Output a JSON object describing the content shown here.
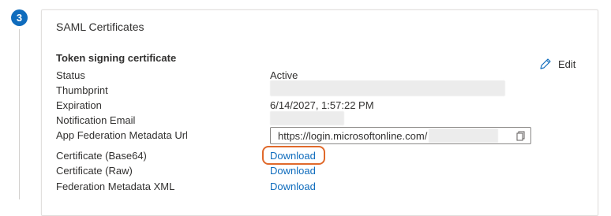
{
  "step": {
    "number": "3"
  },
  "card": {
    "title": "SAML Certificates",
    "section_title": "Token signing certificate",
    "edit_label": "Edit"
  },
  "rows": {
    "status": {
      "label": "Status",
      "value": "Active"
    },
    "thumbprint": {
      "label": "Thumbprint"
    },
    "expiration": {
      "label": "Expiration",
      "value": "6/14/2027, 1:57:22 PM"
    },
    "notification_email": {
      "label": "Notification Email"
    },
    "metadata_url": {
      "label": "App Federation Metadata Url",
      "value": "https://login.microsoftonline.com/"
    },
    "cert_base64": {
      "label": "Certificate (Base64)",
      "link": "Download"
    },
    "cert_raw": {
      "label": "Certificate (Raw)",
      "link": "Download"
    },
    "federation_xml": {
      "label": "Federation Metadata XML",
      "link": "Download"
    }
  },
  "colors": {
    "accent": "#0f6cbd",
    "highlight": "#e0692b",
    "text": "#323130"
  },
  "icons": {
    "edit": "pencil-icon",
    "copy": "copy-icon"
  }
}
